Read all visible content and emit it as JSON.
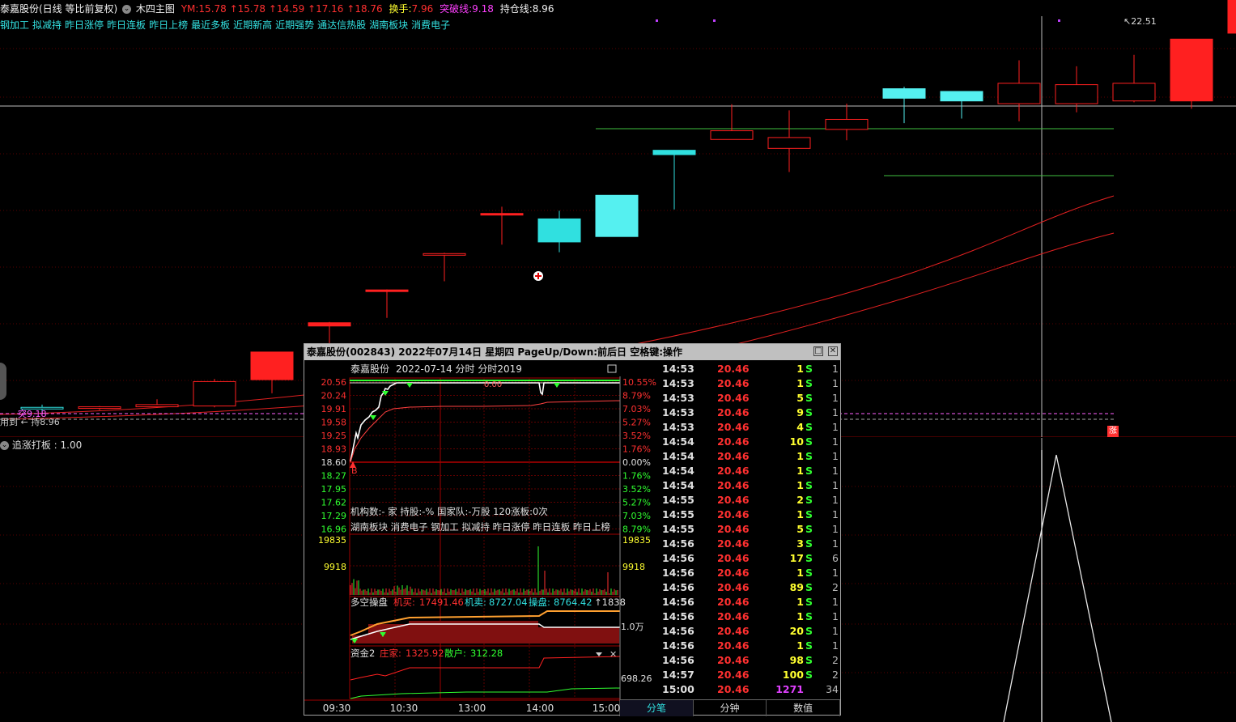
{
  "header": {
    "stock_title": "泰嘉股份(日线 等比前复权)",
    "indicator_name": "木四主图",
    "ym_label": "YM:",
    "ym_values": "15.78 ↑15.78 ↑14.59 ↑17.16 ↑18.76",
    "turnover_label": "换手:",
    "turnover_value": "7.96",
    "breakout_label": "突破线:",
    "breakout_value": "9.18",
    "hold_label": "持仓线:",
    "hold_value": "8.96"
  },
  "concept_tags": [
    "钢加工",
    "拟减持",
    "昨日涨停",
    "昨日连板",
    "昨日上榜",
    "最近多板",
    "近期新高",
    "近期强势",
    "通达信热股",
    "湖南板块",
    "消费电子"
  ],
  "main_chart": {
    "high_label": "22.51",
    "left_marker_1": "突9.18",
    "left_marker_2": "用到 ← 持8.96",
    "zhang_badge": "涨"
  },
  "sub_chart": {
    "label": "追涨打板 : 1.00"
  },
  "popup": {
    "title": "泰嘉股份(002843)  2022年07月14日 星期四 PageUp/Down:前后日 空格键:操作",
    "subtitle_name": "泰嘉股份",
    "subtitle_info": "2022-07-14 分时 分时2019",
    "price_labels_left": [
      "20.56",
      "20.24",
      "19.91",
      "19.58",
      "19.25",
      "18.93",
      "18.60",
      "18.27",
      "17.95",
      "17.62",
      "17.29",
      "16.96"
    ],
    "pct_labels_right": [
      "10.55%",
      "8.79%",
      "7.03%",
      "5.27%",
      "3.52%",
      "1.76%",
      "0.00%",
      "1.76%",
      "3.52%",
      "5.27%",
      "7.03%",
      "8.79%"
    ],
    "info_line_1": "机构数:- 家 持股:-% 国家队:-万股 120涨板:0次",
    "info_line_2": "湖南板块 消费电子 钢加工 拟减持 昨日涨停 昨日连板 昨日上榜",
    "vol_top": "19835",
    "vol_mid": "9918",
    "dk_label": "多空操盘",
    "dk_jm_label": "机买:",
    "dk_jm_value": "17491.46",
    "dk_js_label": "机卖:",
    "dk_js_value": "8727.04",
    "dk_cp_label": "操盘:",
    "dk_cp_value": "8764.42",
    "dk_extra": "↑1838",
    "dk_right": "1.0万",
    "zj_label": "资金2",
    "zj_zj_label": "庄家:",
    "zj_zj_value": "1325.92",
    "zj_sh_label": "散户:",
    "zj_sh_value": "312.28",
    "zj_right": "698.26",
    "time_labels": [
      "09:30",
      "10:30",
      "13:00",
      "14:00",
      "15:00"
    ],
    "op_label": "操作",
    "inner_mark": "0.00",
    "b_mark": "B"
  },
  "ticks": [
    {
      "t": "14:53",
      "p": "20.46",
      "v": "1",
      "s": "S",
      "n": "1"
    },
    {
      "t": "14:53",
      "p": "20.46",
      "v": "1",
      "s": "S",
      "n": "1"
    },
    {
      "t": "14:53",
      "p": "20.46",
      "v": "5",
      "s": "S",
      "n": "1"
    },
    {
      "t": "14:53",
      "p": "20.46",
      "v": "9",
      "s": "S",
      "n": "1"
    },
    {
      "t": "14:53",
      "p": "20.46",
      "v": "4",
      "s": "S",
      "n": "1"
    },
    {
      "t": "14:54",
      "p": "20.46",
      "v": "10",
      "s": "S",
      "n": "1"
    },
    {
      "t": "14:54",
      "p": "20.46",
      "v": "1",
      "s": "S",
      "n": "1"
    },
    {
      "t": "14:54",
      "p": "20.46",
      "v": "1",
      "s": "S",
      "n": "1"
    },
    {
      "t": "14:54",
      "p": "20.46",
      "v": "1",
      "s": "S",
      "n": "1"
    },
    {
      "t": "14:55",
      "p": "20.46",
      "v": "2",
      "s": "S",
      "n": "1"
    },
    {
      "t": "14:55",
      "p": "20.46",
      "v": "1",
      "s": "S",
      "n": "1"
    },
    {
      "t": "14:55",
      "p": "20.46",
      "v": "5",
      "s": "S",
      "n": "1"
    },
    {
      "t": "14:56",
      "p": "20.46",
      "v": "3",
      "s": "S",
      "n": "1"
    },
    {
      "t": "14:56",
      "p": "20.46",
      "v": "17",
      "s": "S",
      "n": "6"
    },
    {
      "t": "14:56",
      "p": "20.46",
      "v": "1",
      "s": "S",
      "n": "1"
    },
    {
      "t": "14:56",
      "p": "20.46",
      "v": "89",
      "s": "S",
      "n": "2"
    },
    {
      "t": "14:56",
      "p": "20.46",
      "v": "1",
      "s": "S",
      "n": "1"
    },
    {
      "t": "14:56",
      "p": "20.46",
      "v": "1",
      "s": "S",
      "n": "1"
    },
    {
      "t": "14:56",
      "p": "20.46",
      "v": "20",
      "s": "S",
      "n": "1"
    },
    {
      "t": "14:56",
      "p": "20.46",
      "v": "1",
      "s": "S",
      "n": "1"
    },
    {
      "t": "14:56",
      "p": "20.46",
      "v": "98",
      "s": "S",
      "n": "2"
    },
    {
      "t": "14:57",
      "p": "20.46",
      "v": "100",
      "s": "S",
      "n": "2"
    },
    {
      "t": "15:00",
      "p": "20.46",
      "v": "1271",
      "s": "",
      "n": "34"
    }
  ],
  "tabs": [
    "分笔",
    "分钟",
    "数值"
  ],
  "candles": [
    {
      "o": 9.0,
      "h": 9.1,
      "l": 8.85,
      "c": 8.95
    },
    {
      "o": 8.96,
      "h": 9.05,
      "l": 8.9,
      "c": 9.02
    },
    {
      "o": 9.02,
      "h": 9.3,
      "l": 8.98,
      "c": 9.1
    },
    {
      "o": 9.05,
      "h": 10.05,
      "l": 9.0,
      "c": 9.95
    },
    {
      "o": 10.02,
      "h": 10.3,
      "l": 9.52,
      "c": 11.04
    },
    {
      "o": 12.0,
      "h": 12.15,
      "l": 11.1,
      "c": 12.12
    },
    {
      "o": 13.3,
      "h": 13.35,
      "l": 12.3,
      "c": 13.33
    },
    {
      "o": 14.65,
      "h": 14.7,
      "l": 13.65,
      "c": 14.67
    },
    {
      "o": 16.1,
      "h": 16.4,
      "l": 15.0,
      "c": 16.15
    },
    {
      "o": 15.95,
      "h": 16.25,
      "l": 14.72,
      "c": 15.1
    },
    {
      "o": 15.3,
      "h": 16.8,
      "l": 15.3,
      "c": 16.82
    },
    {
      "o": 18.48,
      "h": 18.49,
      "l": 16.3,
      "c": 18.32
    },
    {
      "o": 18.88,
      "h": 20.18,
      "l": 19.05,
      "c": 19.2
    },
    {
      "o": 18.55,
      "h": 19.95,
      "l": 17.68,
      "c": 18.95
    },
    {
      "o": 19.25,
      "h": 20.2,
      "l": 18.85,
      "c": 19.62
    },
    {
      "o": 20.75,
      "h": 20.82,
      "l": 19.48,
      "c": 20.4
    },
    {
      "o": 20.65,
      "h": 20.6,
      "l": 19.65,
      "c": 20.3
    },
    {
      "o": 20.2,
      "h": 21.8,
      "l": 19.55,
      "c": 20.95
    },
    {
      "o": 20.2,
      "h": 21.58,
      "l": 19.88,
      "c": 20.9
    },
    {
      "o": 20.3,
      "h": 22.0,
      "l": 20.25,
      "c": 20.95
    },
    {
      "o": 20.3,
      "h": 21.96,
      "l": 20.01,
      "c": 22.58
    },
    {
      "o": 22.8,
      "h": 22.75,
      "l": 21.62,
      "c": 24.7
    }
  ]
}
